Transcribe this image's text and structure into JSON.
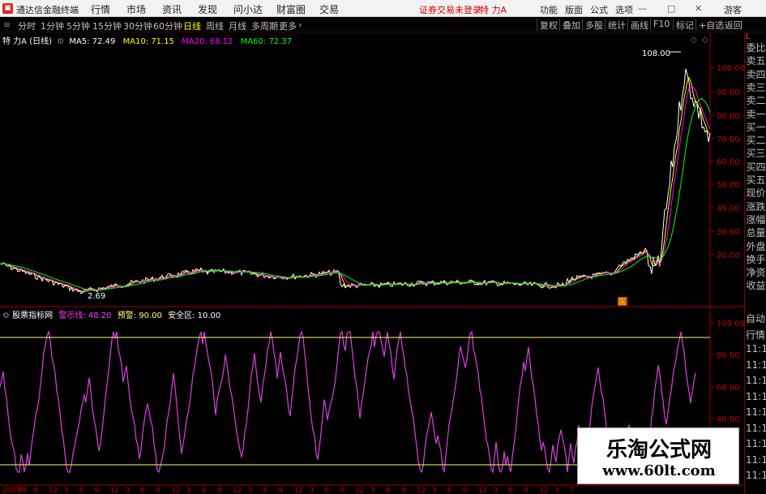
{
  "titlebar": {
    "app_title": "通达信金融终端",
    "menus": [
      "行情",
      "市场",
      "资讯",
      "发现",
      "问小达",
      "财富圈",
      "交易"
    ],
    "login_status": "证券交易未登录",
    "stock_name": "特 力A",
    "right_menus": [
      "功能",
      "版面",
      "公式",
      "选项"
    ],
    "user": "游客"
  },
  "toolbar": {
    "periods": [
      "分时",
      "1分钟",
      "5分钟",
      "15分钟",
      "30分钟",
      "60分钟",
      "日线",
      "周线",
      "月线",
      "多周期",
      "更多"
    ],
    "active_period": "日线",
    "buttons": [
      "复权",
      "叠加",
      "多股",
      "统计",
      "画线",
      "F10",
      "标记",
      "+自选",
      "返回"
    ]
  },
  "main_chart": {
    "stock_label": "特 力A",
    "period_label": "(日线)",
    "ma5": "MA5: 72.49",
    "ma10": "MA10: 71.15",
    "ma20": "MA20: 68.12",
    "ma60": "MA60: 72.37",
    "price_ticks": [
      "100.00",
      "90.00",
      "80.00",
      "70.00",
      "60.00",
      "50.00",
      "40.00",
      "30.00",
      "20.00"
    ],
    "high_label": "108.00",
    "low_label": "2.69",
    "marker": "国"
  },
  "indicator": {
    "name": "股票指标网",
    "signal": "警示线: 48.20",
    "warning": "预警: 90.00",
    "safe": "安全区: 10.00",
    "ticks": [
      "100.00",
      "80.00",
      "60.00",
      "40.00"
    ]
  },
  "time_axis": [
    "2007年",
    "6",
    "9",
    "12",
    "3",
    "6",
    "9",
    "12",
    "3",
    "6",
    "9",
    "12",
    "3",
    "6",
    "9",
    "12",
    "3",
    "6",
    "9",
    "12",
    "3",
    "6",
    "9",
    "12",
    "3",
    "6",
    "9",
    "12",
    "3",
    "6",
    "9",
    "12",
    "3",
    "6",
    "9",
    "12",
    "3",
    "7"
  ],
  "sidebar": {
    "labels": [
      "委比",
      "卖五",
      "卖四",
      "卖三",
      "卖二",
      "卖一",
      "买一",
      "买二",
      "买三",
      "买四",
      "买五",
      "现价",
      "涨跌",
      "涨幅",
      "总量",
      "外盘",
      "换手",
      "净资",
      "收益"
    ],
    "lower_labels": [
      "自动",
      "行情",
      "11:1",
      "11:1",
      "11:1",
      "11:1",
      "11:1",
      "11:1",
      "11:1",
      "11:1",
      "11:1"
    ],
    "corner": "L"
  },
  "watermark": {
    "title": "乐淘公式网",
    "url": "www.60lt.com"
  },
  "colors": {
    "price_line": "#ffffff",
    "ma5": "#ffffff",
    "ma10": "#ffff00",
    "ma20": "#ff00ff",
    "ma60": "#00ff00",
    "indicator_line": "#e040e0",
    "warning_line": "#ffff80",
    "axis": "#a00000"
  }
}
